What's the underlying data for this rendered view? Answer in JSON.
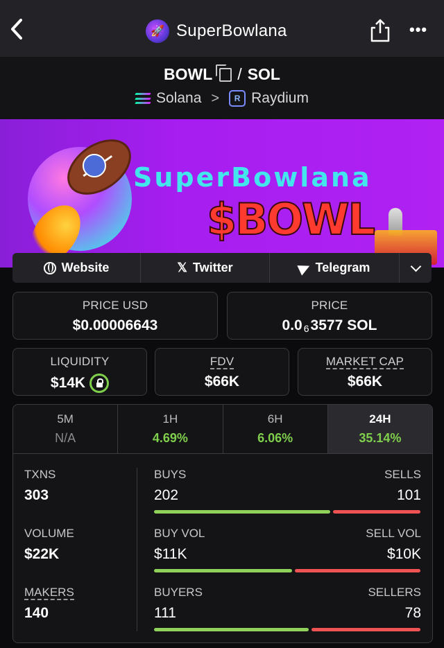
{
  "header": {
    "title": "SuperBowlana",
    "more_label": "•••"
  },
  "pair": {
    "base": "BOWL",
    "separator": "/",
    "quote": "SOL",
    "chain": "Solana",
    "dex": "Raydium",
    "chevron": ">"
  },
  "banner": {
    "name": "SuperBowlana",
    "ticker": "$BOWL"
  },
  "links": [
    {
      "label": "Website"
    },
    {
      "label": "Twitter"
    },
    {
      "label": "Telegram"
    }
  ],
  "prices": {
    "usd_label": "PRICE USD",
    "usd_value": "$0.00006643",
    "native_label": "PRICE",
    "native_prefix": "0.0",
    "native_subscript": "6",
    "native_digits": "3577",
    "native_unit": "SOL"
  },
  "metrics": {
    "liquidity_label": "LIQUIDITY",
    "liquidity_value": "$14K",
    "fdv_label": "FDV",
    "fdv_value": "$66K",
    "mcap_label": "MARKET CAP",
    "mcap_value": "$66K"
  },
  "timeframes": [
    {
      "label": "5M",
      "value": "N/A"
    },
    {
      "label": "1H",
      "value": "4.69%"
    },
    {
      "label": "6H",
      "value": "6.06%"
    },
    {
      "label": "24H",
      "value": "35.14%",
      "active": true
    }
  ],
  "activity": {
    "txns_label": "TXNS",
    "txns": "303",
    "buys_label": "BUYS",
    "buys": "202",
    "sells_label": "SELLS",
    "sells": "101",
    "volume_label": "VOLUME",
    "volume": "$22K",
    "buyvol_label": "BUY VOL",
    "buyvol": "$11K",
    "sellvol_label": "SELL VOL",
    "sellvol": "$10K",
    "makers_label": "MAKERS",
    "makers": "140",
    "buyers_label": "BUYERS",
    "buyers": "111",
    "sellers_label": "SELLERS",
    "sellers": "78"
  },
  "ratios": {
    "buys_fraction": 0.667,
    "buyvol_fraction": 0.524,
    "buyers_fraction": 0.587
  },
  "colors": {
    "positive": "#8fd15a",
    "negative": "#f05353",
    "banner": "#a61ef0"
  },
  "icons": [
    "back-arrow-icon",
    "app-logo-icon",
    "share-icon",
    "more-icon",
    "copy-icon",
    "solana-icon",
    "raydium-icon",
    "globe-icon",
    "x-icon",
    "telegram-icon",
    "chevron-down-icon",
    "lock-icon"
  ]
}
